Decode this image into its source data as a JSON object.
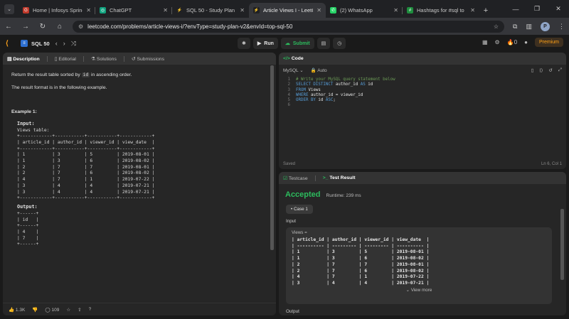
{
  "browser": {
    "tabs": [
      {
        "title": "Home | Infosys Springboard",
        "color": "#c0392b",
        "glyph": "G"
      },
      {
        "title": "ChatGPT",
        "color": "#10a37f",
        "glyph": "◎"
      },
      {
        "title": "SQL 50 - Study Plan",
        "color": "#202124",
        "glyph": "⚡"
      },
      {
        "title": "Article Views I - LeetCode",
        "color": "#202124",
        "glyph": "⚡"
      },
      {
        "title": "(2) WhatsApp",
        "color": "#25d366",
        "glyph": "✆"
      },
      {
        "title": "Hashtags for #sql to",
        "color": "#1e8e3e",
        "glyph": "#"
      }
    ],
    "url": "leetcode.com/problems/article-views-i/?envType=study-plan-v2&envId=top-sql-50"
  },
  "header": {
    "plan_title": "SQL 50",
    "run_label": "Run",
    "submit_label": "Submit",
    "streak": "0",
    "premium_label": "Premium"
  },
  "left": {
    "tabs": [
      "Description",
      "Editorial",
      "Solutions",
      "Submissions"
    ],
    "desc_line1_pre": "Return the result table sorted by ",
    "desc_line1_code": "id",
    "desc_line1_post": " in ascending order.",
    "desc_line2": "The result format is in the following example.",
    "example_title": "Example 1:",
    "input_label": "Input:",
    "views_label": "Views table:",
    "input_table": "+------------+-----------+-----------+------------+\n| article_id | author_id | viewer_id | view_date  |\n+------------+-----------+-----------+------------+\n| 1          | 3         | 5         | 2019-08-01 |\n| 1          | 3         | 6         | 2019-08-02 |\n| 2          | 7         | 7         | 2019-08-01 |\n| 2          | 7         | 6         | 2019-08-02 |\n| 4          | 7         | 1         | 2019-07-22 |\n| 3          | 4         | 4         | 2019-07-21 |\n| 3          | 4         | 4         | 2019-07-21 |\n+------------+-----------+-----------+------------+",
    "output_label": "Output:",
    "output_table": "+------+\n| id   |\n+------+\n| 4    |\n| 7    |\n+------+",
    "likes": "1.3K",
    "comments": "109"
  },
  "code": {
    "title": "Code",
    "lang": "MySQL",
    "mode": "Auto",
    "lines": [
      {
        "n": "1",
        "html": "<span class='cm'># Write your MySQL query statement below</span>"
      },
      {
        "n": "2",
        "html": "<span class='kw'>SELECT DISTINCT</span> author_id <span class='kw'>AS</span> id"
      },
      {
        "n": "3",
        "html": "<span class='kw'>FROM</span> Views"
      },
      {
        "n": "4",
        "html": "<span class='kw'>WHERE</span> author_id = viewer_id"
      },
      {
        "n": "5",
        "html": "<span class='kw'>ORDER BY</span> id <span class='kw'>ASC</span>;"
      },
      {
        "n": "6",
        "html": ""
      }
    ],
    "saved": "Saved",
    "cursor": "Ln 6, Col 1"
  },
  "result": {
    "tab1": "Testcase",
    "tab2": "Test Result",
    "status": "Accepted",
    "runtime": "Runtime: 239 ms",
    "case": "Case 1",
    "input_label": "Input",
    "views_label": "Views =",
    "table": "| article_id | author_id | viewer_id | view_date  |\n| ---------- | --------- | --------- | ---------- |\n| 1          | 3         | 5         | 2019-08-01 |\n| 1          | 3         | 6         | 2019-08-02 |\n| 2          | 7         | 7         | 2019-08-01 |\n| 2          | 7         | 6         | 2019-08-02 |\n| 4          | 7         | 1         | 2019-07-22 |\n| 3          | 4         | 4         | 2019-07-21 |",
    "view_more": "View more",
    "output_label": "Output"
  }
}
